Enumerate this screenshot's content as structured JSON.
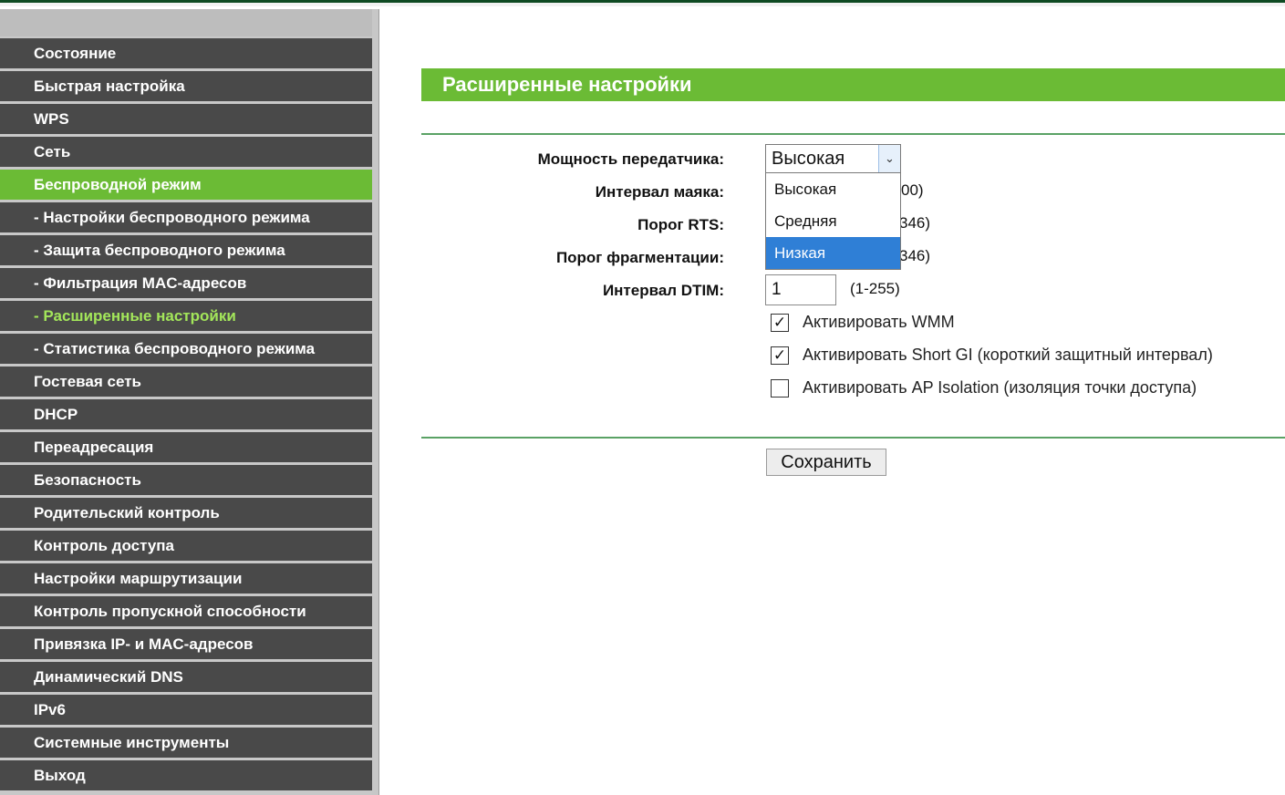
{
  "sidebar": {
    "items": [
      {
        "label": "Состояние"
      },
      {
        "label": "Быстрая настройка"
      },
      {
        "label": "WPS"
      },
      {
        "label": "Сеть"
      },
      {
        "label": "Беспроводной режим"
      },
      {
        "label": "- Настройки беспроводного режима"
      },
      {
        "label": "- Защита беспроводного режима"
      },
      {
        "label": "- Фильтрация MAC-адресов"
      },
      {
        "label": "- Расширенные настройки"
      },
      {
        "label": "- Статистика беспроводного режима"
      },
      {
        "label": "Гостевая сеть"
      },
      {
        "label": "DHCP"
      },
      {
        "label": "Переадресация"
      },
      {
        "label": "Безопасность"
      },
      {
        "label": "Родительский контроль"
      },
      {
        "label": "Контроль доступа"
      },
      {
        "label": "Настройки маршрутизации"
      },
      {
        "label": "Контроль пропускной способности"
      },
      {
        "label": "Привязка IP- и MAC-адресов"
      },
      {
        "label": "Динамический DNS"
      },
      {
        "label": "IPv6"
      },
      {
        "label": "Системные инструменты"
      },
      {
        "label": "Выход"
      }
    ]
  },
  "main": {
    "title": "Расширенные настройки",
    "tx_power": {
      "label": "Мощность передатчика:",
      "value": "Высокая",
      "options": [
        "Высокая",
        "Средняя",
        "Низкая"
      ],
      "highlighted": "Низкая"
    },
    "beacon": {
      "label": "Интервал маяка:",
      "hint_visible": "00)"
    },
    "rts": {
      "label": "Порог RTS:",
      "hint_visible": "346)"
    },
    "frag": {
      "label": "Порог фрагментации:",
      "hint_visible": "346)"
    },
    "dtim": {
      "label": "Интервал DTIM:",
      "value": "1",
      "hint": "(1-255)"
    },
    "checkboxes": [
      {
        "label": "Активировать WMM",
        "checked": true,
        "mark": "✓"
      },
      {
        "label": "Активировать Short GI (короткий защитный интервал)",
        "checked": true,
        "mark": "✓"
      },
      {
        "label": "Активировать AP Isolation (изоляция точки доступа)",
        "checked": false,
        "mark": ""
      }
    ],
    "save_label": "Сохранить"
  },
  "colors": {
    "accent_green": "#6bbb35",
    "sidebar_bg": "#494949",
    "selection_blue": "#2f7fd6"
  }
}
